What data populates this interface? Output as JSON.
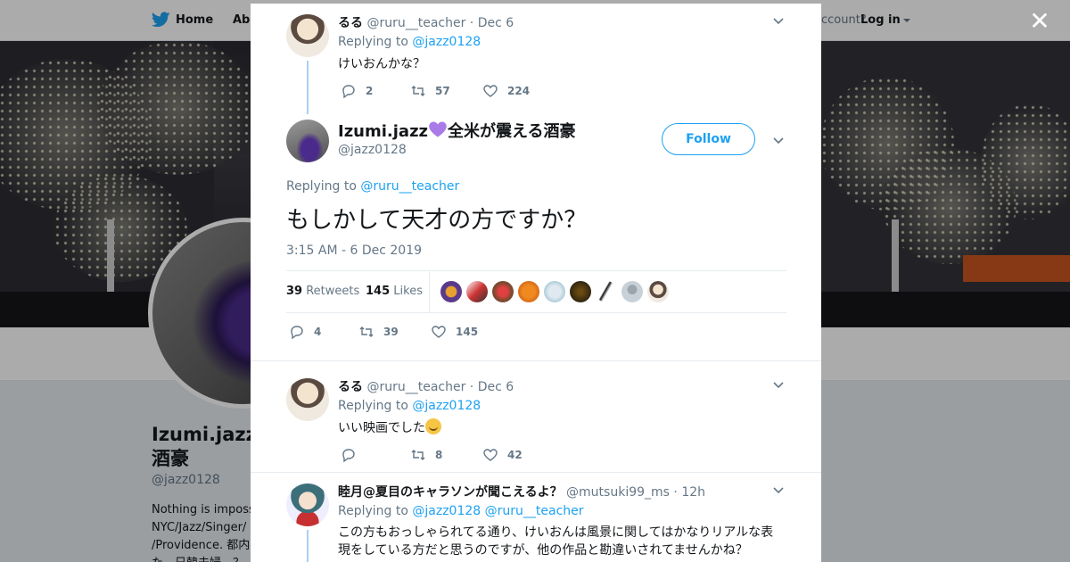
{
  "nav": {
    "home_label": "Home",
    "about_label": "Abo",
    "account_prompt": "ccount?",
    "login_label": "Log in"
  },
  "profile": {
    "name": "Izumi.jazz",
    "name_line2": "酒豪",
    "handle": "@jazz0128",
    "bio_lines": [
      "Nothing is imposs",
      "NYC/Jazz/Singer/",
      "/Providence. 都内",
      "た。日韓夫婦。？"
    ]
  },
  "modal": {
    "close_label": "✕",
    "tweets": [
      {
        "name": "るる",
        "handle": "@ruru__teacher",
        "date": "· Dec 6",
        "replying_prefix": "Replying to",
        "replying_to": "@jazz0128",
        "text": "けいおんかな？",
        "replies": "2",
        "retweets": "57",
        "likes": "224"
      },
      {
        "name": "るる",
        "handle": "@ruru__teacher",
        "date": "· Dec 6",
        "replying_prefix": "Replying to",
        "replying_to": "@jazz0128",
        "text": "いい映画でした",
        "replies": "",
        "retweets": "8",
        "likes": "42"
      },
      {
        "name": "睦月@夏目のキャラソンが聞こえるよ？",
        "handle": "@mutsuki99_ms",
        "date": "· 12h",
        "replying_prefix": "Replying to",
        "replying_to": "@jazz0128",
        "replying_to_2": "@ruru__teacher",
        "text_line1": "この方もおっしゃられてる通り、けいおんは風景に関してはかなりリアルな表",
        "text_line2": "現をしている方だと思うのですが、他の作品と勘違いされてませんかね？"
      }
    ],
    "main": {
      "name": "Izumi.jazz",
      "name_suffix": "全米が震える酒豪",
      "handle": "@jazz0128",
      "follow_label": "Follow",
      "replying_prefix": "Replying to",
      "replying_to": "@ruru__teacher",
      "text": "もしかして天才の方ですか？",
      "timestamp": "3:15 AM - 6 Dec 2019",
      "retweets_count": "39",
      "retweets_label": "Retweets",
      "likes_count": "145",
      "likes_label": "Likes",
      "replies": "4",
      "retweets": "39",
      "likes": "145"
    }
  },
  "colors": {
    "link": "#1da1f2",
    "heart_purple": "#a97be8",
    "thread_line": "#a8d1f2"
  }
}
